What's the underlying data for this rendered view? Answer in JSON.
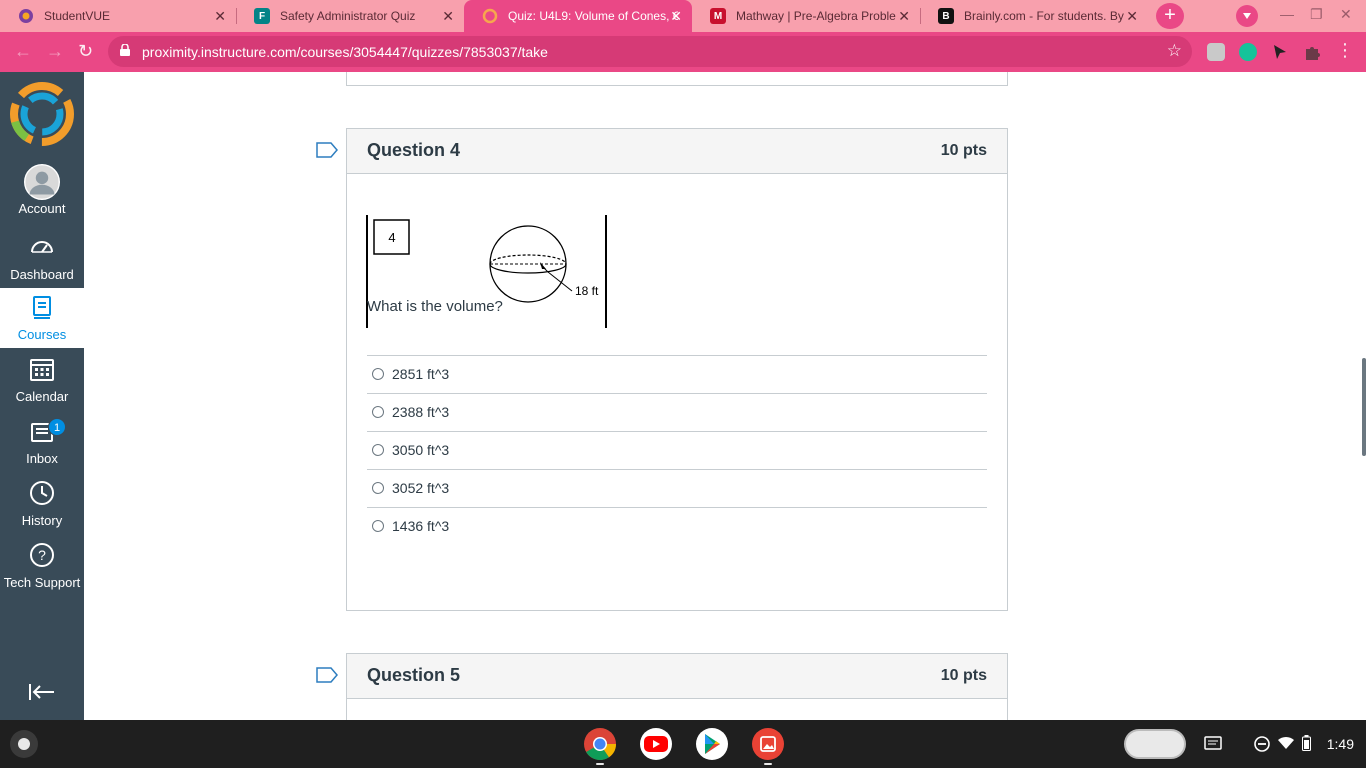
{
  "browser": {
    "tabs": [
      {
        "title": "StudentVUE",
        "active": false,
        "favicon": "studentvue-icon"
      },
      {
        "title": "Safety Administrator Quiz",
        "active": false,
        "favicon": "forms-icon"
      },
      {
        "title": "Quiz: U4L9: Volume of Cones, C",
        "active": true,
        "favicon": "canvas-icon"
      },
      {
        "title": "Mathway | Pre-Algebra Proble",
        "active": false,
        "favicon": "mathway-icon"
      },
      {
        "title": "Brainly.com - For students. By",
        "active": false,
        "favicon": "brainly-icon"
      }
    ],
    "new_tab": "+",
    "url": "proximity.instructure.com/courses/3054447/quizzes/7853037/take",
    "accent": "#ea4886",
    "tab_strip_color": "#f8a0ad"
  },
  "nav": {
    "items": [
      {
        "label": "Account",
        "icon": "account-icon"
      },
      {
        "label": "Dashboard",
        "icon": "dashboard-icon"
      },
      {
        "label": "Courses",
        "icon": "courses-icon",
        "active": true
      },
      {
        "label": "Calendar",
        "icon": "calendar-icon"
      },
      {
        "label": "Inbox",
        "icon": "inbox-icon",
        "badge": "1"
      },
      {
        "label": "History",
        "icon": "history-icon"
      },
      {
        "label": "Tech Support",
        "icon": "help-icon"
      }
    ],
    "collapse_icon": "collapse-nav-icon",
    "background": "#394b58",
    "active_color": "#008ee2"
  },
  "quiz": {
    "q4": {
      "title": "Question 4",
      "points": "10 pts",
      "figure": {
        "box_label": "4",
        "dimension_label": "18 ft"
      },
      "prompt": "What is the volume?",
      "answers": [
        "2851 ft^3",
        "2388 ft^3",
        "3050 ft^3",
        "3052 ft^3",
        "1436 ft^3"
      ]
    },
    "q5": {
      "title": "Question 5",
      "points": "10 pts"
    }
  },
  "shelf": {
    "apps": [
      "chrome-icon",
      "youtube-icon",
      "play-store-icon",
      "gallery-icon"
    ],
    "time": "1:49"
  }
}
